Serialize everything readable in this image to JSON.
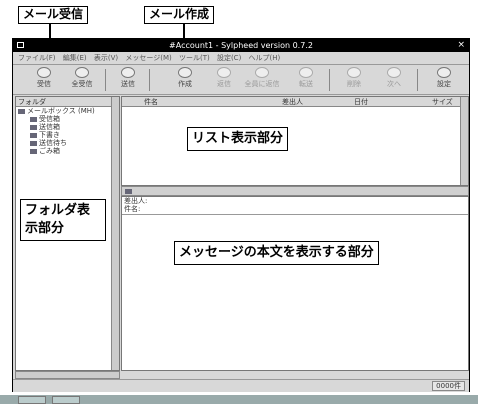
{
  "annotations": {
    "receive_label": "メール受信",
    "compose_label": "メール作成",
    "list_label": "リスト表示部分",
    "folder_label": "フォルダ表示部分",
    "message_label": "メッセージの本文を表示する部分"
  },
  "window": {
    "title": "#Account1 - Sylpheed version 0.7.2",
    "close": "×"
  },
  "menu": [
    "ファイル(F)",
    "編集(E)",
    "表示(V)",
    "メッセージ(M)",
    "ツール(T)",
    "設定(C)",
    "ヘルプ(H)"
  ],
  "toolbar": [
    {
      "label": "受信",
      "icon": "receive-icon",
      "enabled": true
    },
    {
      "label": "全受信",
      "icon": "receive-all-icon",
      "enabled": true
    },
    {
      "label": "送信",
      "icon": "send-icon",
      "enabled": true
    },
    {
      "label": "作成",
      "icon": "compose-icon",
      "enabled": true
    },
    {
      "label": "返信",
      "icon": "reply-icon",
      "enabled": false
    },
    {
      "label": "全員に返信",
      "icon": "reply-all-icon",
      "enabled": false
    },
    {
      "label": "転送",
      "icon": "forward-icon",
      "enabled": false
    },
    {
      "label": "削除",
      "icon": "delete-icon",
      "enabled": false
    },
    {
      "label": "次へ",
      "icon": "next-icon",
      "enabled": false
    },
    {
      "label": "設定",
      "icon": "settings-icon",
      "enabled": true
    }
  ],
  "folder_pane": {
    "header": "フォルダ",
    "items": [
      "メールボックス (MH)",
      "受信箱",
      "送信箱",
      "下書き",
      "送信待ち",
      "ごみ箱"
    ]
  },
  "list_pane": {
    "columns": [
      "",
      "",
      "件名",
      "差出人",
      "日付",
      "サイズ"
    ]
  },
  "message_pane": {
    "from_label": "差出人:",
    "subject_label": "件名:"
  },
  "statusbar": {
    "status": "0000件"
  }
}
